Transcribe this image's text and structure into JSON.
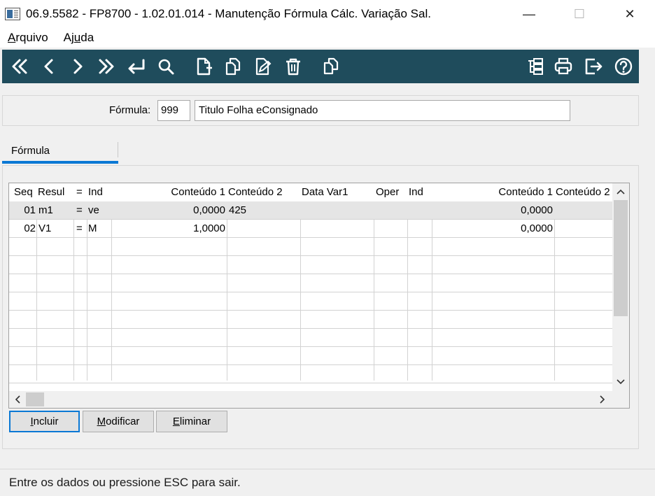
{
  "window": {
    "title": "06.9.5582 - FP8700 - 1.02.01.014 - Manutenção Fórmula Cálc. Variação Sal.",
    "minimize": "—",
    "maximize": "☐",
    "close": "✕"
  },
  "menu": {
    "arquivo_first": "A",
    "arquivo_rest": "rquivo",
    "ajuda_pre": "Aj",
    "ajuda_u": "u",
    "ajuda_post": "da"
  },
  "toolbar": {
    "icons": [
      "first-record-icon",
      "previous-record-icon",
      "next-record-icon",
      "last-record-icon",
      "return-icon",
      "search-icon",
      "new-document-icon",
      "copy-document-icon",
      "edit-document-icon",
      "delete-icon",
      "duplicate-icon",
      "tree-icon",
      "print-icon",
      "exit-icon",
      "help-icon"
    ]
  },
  "header": {
    "formula_label": "Fórmula:",
    "formula_code": "999",
    "formula_desc": "Titulo Folha eConsignado"
  },
  "tab": {
    "label": "Fórmula"
  },
  "grid": {
    "columns": [
      "Seq",
      "Resul",
      "=",
      "Ind",
      "Conteúdo 1",
      "Conteúdo 2",
      "Data Var1",
      "Oper",
      "Ind",
      "Conteúdo 1",
      "Conteúdo 2"
    ],
    "rows": [
      {
        "seq": "01",
        "resul": "m1",
        "eq": "=",
        "ind": "ve",
        "c1": "0,0000",
        "c2": "425",
        "data": "",
        "oper": "",
        "ind2": "",
        "c1b": "0,0000",
        "c2b": ""
      },
      {
        "seq": "02",
        "resul": "V1",
        "eq": "=",
        "ind": "M",
        "c1": "1,0000",
        "c2": "",
        "data": "",
        "oper": "",
        "ind2": "",
        "c1b": "0,0000",
        "c2b": ""
      }
    ]
  },
  "buttons": {
    "incluir_u": "I",
    "incluir_rest": "ncluir",
    "modificar_u": "M",
    "modificar_rest": "odificar",
    "eliminar_u": "E",
    "eliminar_rest": "liminar"
  },
  "status": {
    "text": "Entre os dados ou pressione ESC para sair."
  },
  "colors": {
    "toolbar_bg": "#1f4c5c",
    "accent": "#0a78d4"
  }
}
